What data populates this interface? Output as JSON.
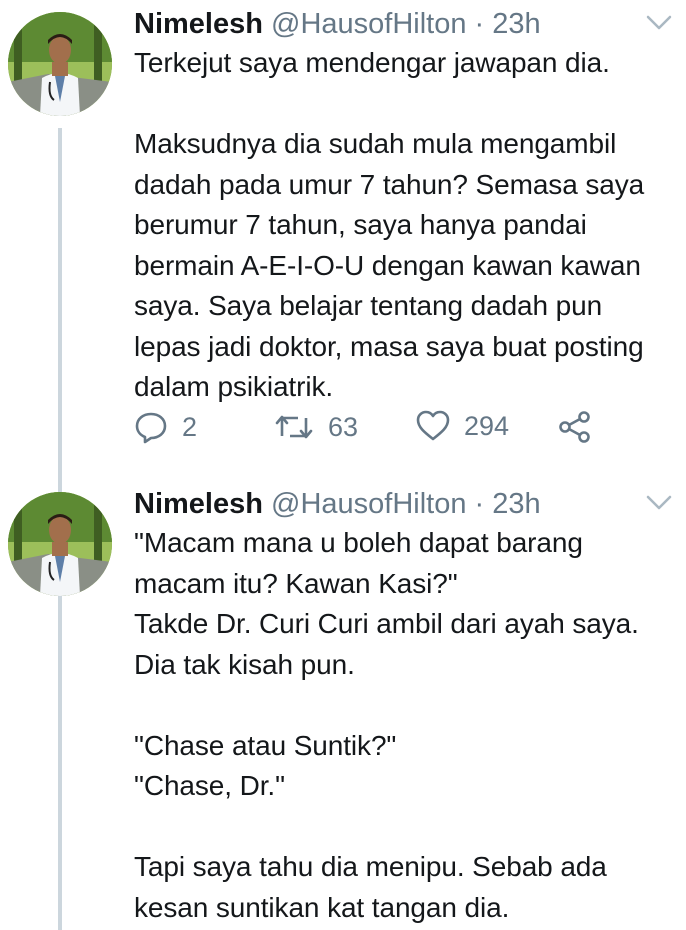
{
  "tweets": [
    {
      "display_name": "Nimelesh",
      "handle": "@HausofHilton",
      "separator": "·",
      "time": "23h",
      "text": "Terkejut saya mendengar jawapan dia.\n\nMaksudnya dia sudah mula mengambil\ndadah pada umur 7 tahun? Semasa saya\nberumur 7 tahun, saya hanya pandai\nbermain A-E-I-O-U dengan kawan kawan\nsaya. Saya belajar tentang dadah pun\nlepas jadi doktor, masa saya buat posting\ndalam psikiatrik.",
      "replies": "2",
      "retweets": "63",
      "likes": "294"
    },
    {
      "display_name": "Nimelesh",
      "handle": "@HausofHilton",
      "separator": "·",
      "time": "23h",
      "text": "\"Macam mana u boleh dapat barang\nmacam itu? Kawan Kasi?\"\nTakde Dr. Curi Curi ambil dari ayah saya.\nDia tak kisah pun.\n\n\"Chase atau Suntik?\"\n\"Chase, Dr.\"\n\nTapi saya tahu dia menipu. Sebab ada\nkesan suntikan kat tangan dia."
    }
  ],
  "colors": {
    "text": "#14171a",
    "secondary": "#657786",
    "thread_line": "#ccd6dd"
  },
  "icons": [
    "avatar-photo",
    "chevron-down-icon",
    "reply-icon",
    "retweet-icon",
    "like-icon",
    "share-icon"
  ]
}
